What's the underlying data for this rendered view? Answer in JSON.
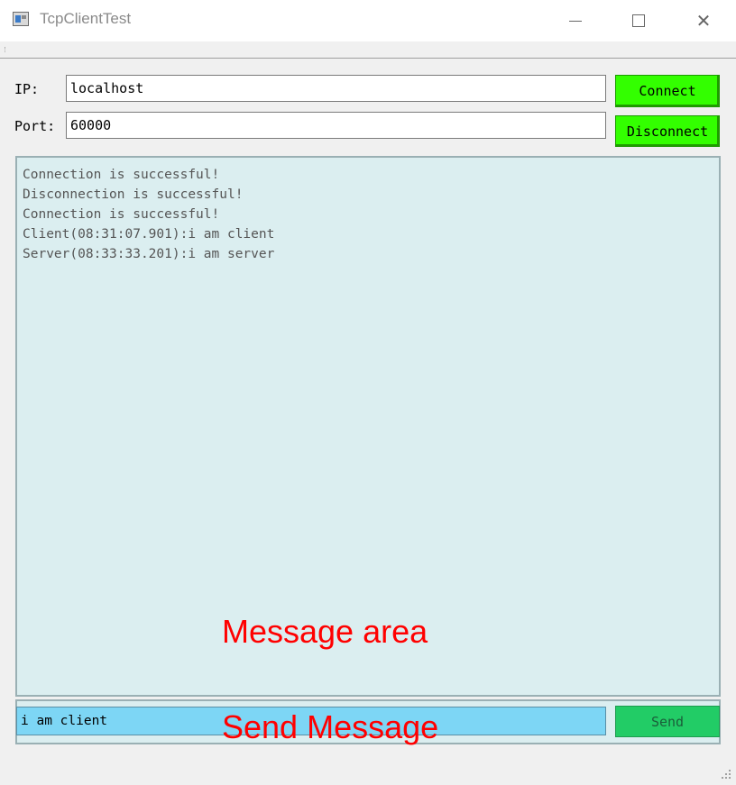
{
  "window": {
    "title": "TcpClientTest",
    "icon": "app-window-icon",
    "controls": [
      "minimize-icon",
      "maximize-icon",
      "close-icon"
    ]
  },
  "connection": {
    "ip_label": "IP:",
    "ip_value": "localhost",
    "port_label": "Port:",
    "port_value": "60000",
    "connect_label": "Connect",
    "disconnect_label": "Disconnect"
  },
  "messages": [
    "Connection is successful!",
    "Disconnection is successful!",
    "Connection is successful!",
    "Client(08:31:07.901):i am client",
    "Server(08:33:33.201):i am server"
  ],
  "send": {
    "input_value": "i am client",
    "send_label": "Send"
  },
  "annotations": {
    "message_area": "Message area",
    "send_message": "Send Message"
  },
  "colors": {
    "connect_button": "#33ff00",
    "send_button": "#22cc66",
    "send_input": "#7dd6f5",
    "message_area": "#dbeef0",
    "annotation": "#ff0000"
  }
}
